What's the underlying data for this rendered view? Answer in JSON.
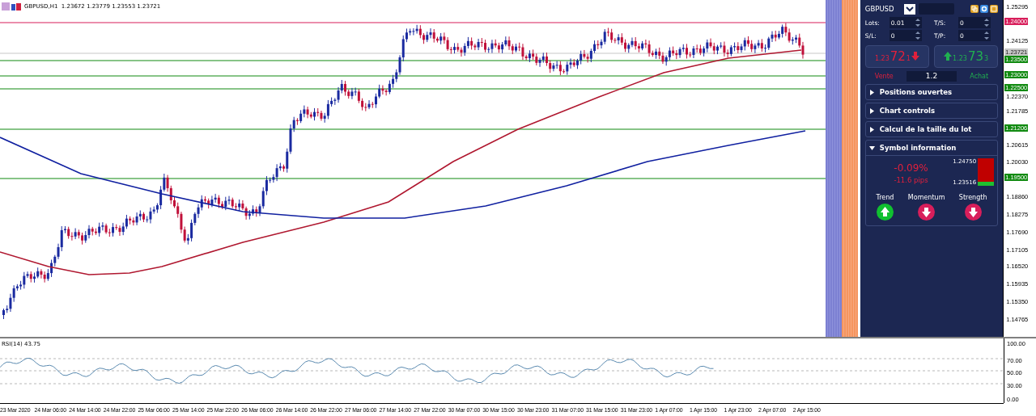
{
  "title_bar": {
    "text": "GBPUSD,H1  1.23672 1.23779 1.23553 1.23721"
  },
  "price_axis": {
    "ticks": [
      "1.25295",
      "1.24125",
      "1.22370",
      "1.21785",
      "1.20615",
      "1.20030",
      "1.18860",
      "1.18275",
      "1.17690",
      "1.17105",
      "1.16520",
      "1.15935",
      "1.15350",
      "1.14765"
    ],
    "badges": [
      {
        "label": "1.24000",
        "color": "#d81e5b"
      },
      {
        "label": "1.23721",
        "color": "#c8c8c8"
      },
      {
        "label": "1.23500",
        "color": "#108a10"
      },
      {
        "label": "1.23000",
        "color": "#108a10"
      },
      {
        "label": "1.22500",
        "color": "#108a10"
      },
      {
        "label": "1.21206",
        "color": "#108a10"
      },
      {
        "label": "1.19500",
        "color": "#108a10"
      }
    ]
  },
  "panel": {
    "symbol": "GBPUSD",
    "fields": [
      {
        "label": "Lots:",
        "value": "0.01"
      },
      {
        "label": "T/S:",
        "value": "0"
      },
      {
        "label": "S/L:",
        "value": "0"
      },
      {
        "label": "T/P:",
        "value": "0"
      }
    ],
    "sell": {
      "small": "1.23",
      "big": "72",
      "sub": "1",
      "label": "Vente"
    },
    "buy": {
      "small": "1.23",
      "big": "73",
      "sub": "3",
      "label": "Achat"
    },
    "volume": "1.2",
    "sections": [
      {
        "title": "Positions ouvertes",
        "expanded": false
      },
      {
        "title": "Chart controls",
        "expanded": false
      },
      {
        "title": "Calcul de la taille du lot",
        "expanded": false
      },
      {
        "title": "Symbol information",
        "expanded": true
      }
    ],
    "symbol_info": {
      "change": "-0.09%",
      "pips": "-11.6 pips",
      "high": "1.24750",
      "low": "1.23516",
      "level": 0.15,
      "signals": [
        {
          "label": "Trend",
          "kind": "up"
        },
        {
          "label": "Momentum",
          "kind": "down"
        },
        {
          "label": "Strength",
          "kind": "down"
        }
      ]
    }
  },
  "rsi": {
    "label": "RSI(14) 43.75",
    "axis": [
      "100.00",
      "70.00",
      "50.00",
      "30.00",
      "0.00"
    ]
  },
  "time_axis": [
    "23 Mar 2020",
    "24 Mar 06:00",
    "24 Mar 14:00",
    "24 Mar 22:00",
    "25 Mar 06:00",
    "25 Mar 14:00",
    "25 Mar 22:00",
    "26 Mar 06:00",
    "26 Mar 14:00",
    "26 Mar 22:00",
    "27 Mar 06:00",
    "27 Mar 14:00",
    "27 Mar 22:00",
    "30 Mar 07:00",
    "30 Mar 15:00",
    "30 Mar 23:00",
    "31 Mar 07:00",
    "31 Mar 15:00",
    "31 Mar 23:00",
    "1 Apr 07:00",
    "1 Apr 15:00",
    "1 Apr 23:00",
    "2 Apr 07:00",
    "2 Apr 15:00"
  ]
}
